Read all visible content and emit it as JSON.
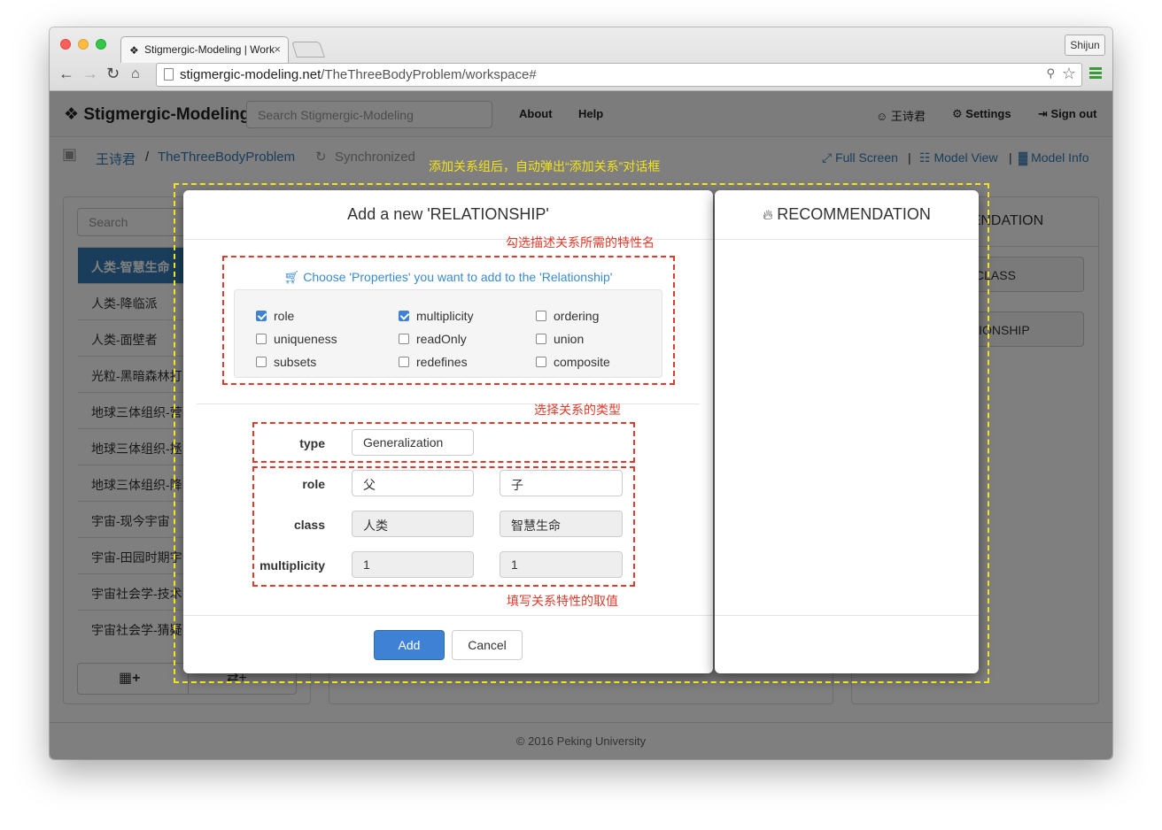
{
  "browser": {
    "tab_title": "Stigmergic-Modeling | Work",
    "tab_close": "×",
    "user_button": "Shijun",
    "url_host": "stigmergic-modeling.net",
    "url_path": "/TheThreeBodyProblem/workspace#"
  },
  "navbar": {
    "brand": "Stigmergic-Modeling",
    "search_placeholder": "Search Stigmergic-Modeling",
    "about": "About",
    "help": "Help",
    "user": "王诗君",
    "settings": "Settings",
    "signout": "Sign out"
  },
  "breadcrumb": {
    "owner": "王诗君",
    "sep": "/",
    "project": "TheThreeBodyProblem",
    "sync": "Synchronized",
    "full_screen": "Full Screen",
    "model_view": "Model View",
    "model_info": "Model Info",
    "divider": "|"
  },
  "left_panel": {
    "search_placeholder": "Search",
    "items": [
      "人类-智慧生命",
      "人类-降临派",
      "人类-面壁者",
      "光粒-黑暗森林打",
      "地球三体组织-营",
      "地球三体组织-拯",
      "地球三体组织-降",
      "宇宙-现今宇宙",
      "宇宙-田园时期宇",
      "宇宙社会学-技术",
      "宇宙社会学-猜疑"
    ]
  },
  "right_panel": {
    "header": "RECOMMENDATION",
    "btn_class": "CLASS",
    "btn_relationship": "RELATIONSHIP"
  },
  "footer": "© 2016 Peking University",
  "dialog": {
    "title": "Add a new 'RELATIONSHIP'",
    "choose_label": "Choose 'Properties' you want to add to the 'Relationship'",
    "properties": [
      {
        "label": "role",
        "checked": true
      },
      {
        "label": "multiplicity",
        "checked": true
      },
      {
        "label": "ordering",
        "checked": false
      },
      {
        "label": "uniqueness",
        "checked": false
      },
      {
        "label": "readOnly",
        "checked": false
      },
      {
        "label": "union",
        "checked": false
      },
      {
        "label": "subsets",
        "checked": false
      },
      {
        "label": "redefines",
        "checked": false
      },
      {
        "label": "composite",
        "checked": false
      }
    ],
    "type_label": "type",
    "type_value": "Generalization",
    "role_label": "role",
    "role_values": [
      "父",
      "子"
    ],
    "class_label": "class",
    "class_values": [
      "人类",
      "智慧生命"
    ],
    "mult_label": "multiplicity",
    "mult_values": [
      "1",
      "1"
    ],
    "add": "Add",
    "cancel": "Cancel"
  },
  "recommendation_dialog": {
    "title": "RECOMMENDATION"
  },
  "annotations": {
    "top": "添加关系组后，自动弹出“添加关系”对话框",
    "props": "勾选描述关系所需的特性名",
    "type": "选择关系的类型",
    "values": "填写关系特性的取值"
  },
  "colors": {
    "primary": "#337ab7",
    "checkbox": "#3f82d5",
    "annotation_red": "#e03a2a",
    "annotation_yellow": "#f3e21c"
  }
}
